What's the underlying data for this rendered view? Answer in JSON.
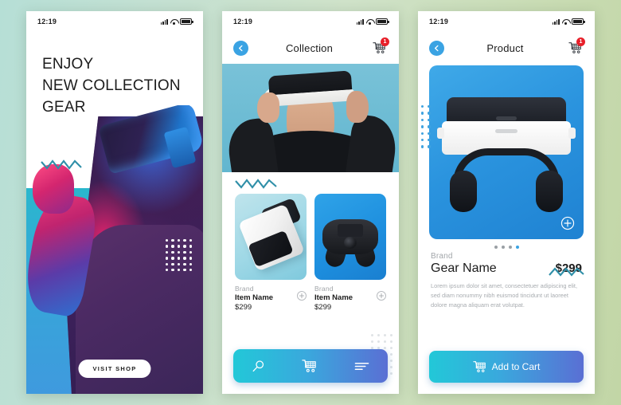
{
  "theme": {
    "bg_gradient_start": "#b6dfd6",
    "bg_gradient_end": "#c2d6a6",
    "accent_blue": "#3aa3e3",
    "accent_cyan": "#22c8d8",
    "accent_indigo": "#5a6fd4",
    "badge_red": "#e8202a",
    "zigzag_color": "#2f8fa8"
  },
  "status_bar": {
    "time": "12:19",
    "signal_icon": "signal-bars-icon",
    "wifi_icon": "wifi-icon",
    "battery_icon": "battery-icon"
  },
  "screen1": {
    "name": "home-screen",
    "headline_line1": "ENJOY",
    "headline_line2": "NEW COLLECTION",
    "headline_line3": "GEAR",
    "cta_label": "VISIT SHOP",
    "zigzag_icon": "zigzag-divider-icon",
    "dot_grid_icon": "dot-grid-icon",
    "photo_alt": "man-wearing-vr-headset-neon-photo"
  },
  "screen2": {
    "name": "collection-screen",
    "title": "Collection",
    "back_icon": "chevron-left-icon",
    "cart_icon": "shopping-cart-icon",
    "cart_badge": "1",
    "hero_alt": "woman-wearing-vr-headset-photo",
    "zigzag_icon": "zigzag-divider-icon",
    "products": [
      {
        "brand": "Brand",
        "name": "Item Name",
        "price": "$299",
        "add_icon": "plus-circle-icon",
        "thumb_alt": "vr-headset-white-photo"
      },
      {
        "brand": "Brand",
        "name": "Item Name",
        "price": "$299",
        "add_icon": "plus-circle-icon",
        "thumb_alt": "game-controller-photo"
      }
    ],
    "bottom_nav": [
      {
        "icon": "search-icon",
        "label": "Search"
      },
      {
        "icon": "shopping-cart-icon",
        "label": "Cart"
      },
      {
        "icon": "menu-lines-icon",
        "label": "Menu"
      }
    ]
  },
  "screen3": {
    "name": "product-screen",
    "title": "Product",
    "back_icon": "chevron-left-icon",
    "cart_icon": "shopping-cart-icon",
    "cart_badge": "1",
    "product_image_alt": "vr-headset-front-view-photo",
    "expand_icon": "plus-circle-icon",
    "dot_grid_icon": "dot-grid-icon",
    "zigzag_icon": "zigzag-divider-icon",
    "carousel_dots": 4,
    "carousel_active_index": 3,
    "brand": "Brand",
    "product_name": "Gear Name",
    "price": "$299",
    "description": "Lorem ipsum dolor sit amet, consectetuer adipiscing elit, sed diam nonummy nibh euismod tincidunt ut laoreet dolore magna aliquam erat volutpat.",
    "add_to_cart_label": "Add to Cart",
    "add_to_cart_icon": "shopping-cart-icon"
  }
}
